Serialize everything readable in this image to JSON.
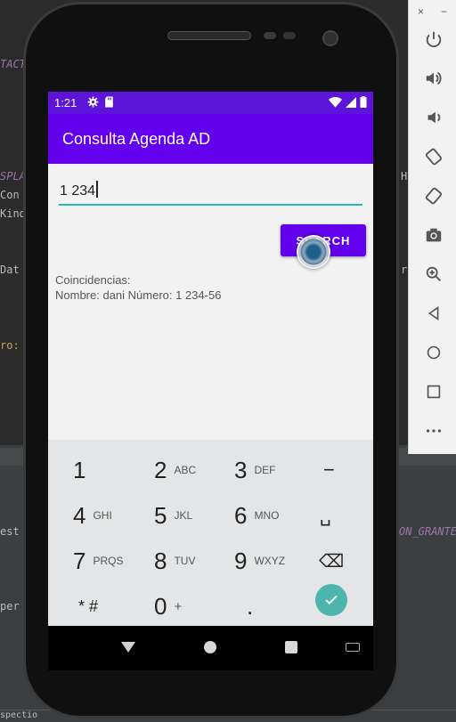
{
  "ide": {
    "left_code": [
      "TACT",
      "SPLA",
      "Con",
      "Kind",
      "Dat",
      "ro:",
      "est",
      "per"
    ],
    "right_code": [
      "H",
      "r",
      "ON_GRANTE"
    ],
    "bottom_text": "spectio"
  },
  "toolbar": {
    "close": "×",
    "minimize": "−",
    "buttons": [
      "power",
      "volume-up",
      "volume-down",
      "rotate-left",
      "rotate-right",
      "camera",
      "zoom",
      "back",
      "home",
      "overview",
      "more"
    ]
  },
  "status_bar": {
    "time": "1:21"
  },
  "app": {
    "title": "Consulta Agenda AD"
  },
  "search": {
    "value": "1 234"
  },
  "search_button": {
    "label": "SEARCH"
  },
  "results": {
    "heading": "Coincidencias:",
    "line": "Nombre: dani Número: 1 234-56"
  },
  "keypad": {
    "keys": [
      {
        "num": "1",
        "letters": ""
      },
      {
        "num": "2",
        "letters": "ABC"
      },
      {
        "num": "3",
        "letters": "DEF"
      },
      {
        "num": "−",
        "letters": ""
      },
      {
        "num": "4",
        "letters": "GHI"
      },
      {
        "num": "5",
        "letters": "JKL"
      },
      {
        "num": "6",
        "letters": "MNO"
      },
      {
        "num": "␣",
        "letters": ""
      },
      {
        "num": "7",
        "letters": "PRQS"
      },
      {
        "num": "8",
        "letters": "TUV"
      },
      {
        "num": "9",
        "letters": "WXYZ"
      },
      {
        "num": "⌫",
        "letters": ""
      },
      {
        "num": "* #",
        "letters": ""
      },
      {
        "num": "0",
        "letters": "+"
      },
      {
        "num": ".",
        "letters": ""
      }
    ]
  },
  "colors": {
    "primary": "#6200ee",
    "primary_dark": "#5c15d8",
    "accent": "#26bdb0",
    "keypad_bg": "#e3e5e7",
    "ok_button": "#4db6ac"
  }
}
